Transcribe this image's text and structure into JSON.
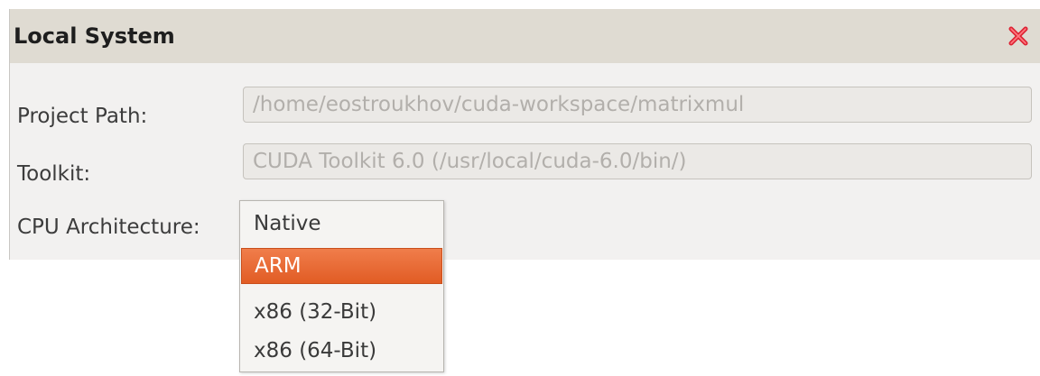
{
  "dialog": {
    "title": "Local System",
    "close_icon": "close-x-icon",
    "close_color": "#dd2233"
  },
  "form": {
    "project_path": {
      "label": "Project Path:",
      "value": "/home/eostroukhov/cuda-workspace/matrixmul"
    },
    "toolkit": {
      "label": "Toolkit:",
      "value": "CUDA Toolkit 6.0 (/usr/local/cuda-6.0/bin/)"
    },
    "cpu_architecture": {
      "label": "CPU Architecture:"
    }
  },
  "dropdown": {
    "options": [
      "Native",
      "ARM",
      "x86 (32-Bit)",
      "x86 (64-Bit)"
    ],
    "selected": "ARM",
    "selected_color": "#e96a34"
  }
}
